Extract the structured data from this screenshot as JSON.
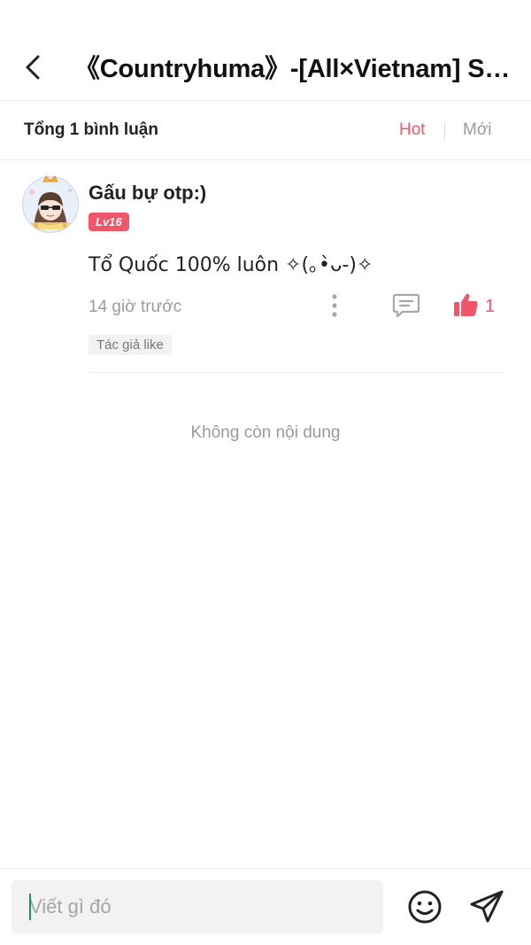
{
  "header": {
    "title": "《Countryhuma》-[All×Vietnam] Sau..."
  },
  "sort_bar": {
    "total_label": "Tổng 1 bình luận",
    "hot_label": "Hot",
    "new_label": "Mới"
  },
  "comments": [
    {
      "username": "Gấu bự otp:)",
      "level": "Lv16",
      "text": "Tổ Quốc 100% luôn ✧(｡•̀ᴗ-)✧",
      "time": "14 giờ trước",
      "likes": "1",
      "author_tag": "Tác giả like"
    }
  ],
  "end_text": "Không còn nội dung",
  "composer": {
    "placeholder": "Viết gì đó"
  },
  "colors": {
    "accent": "#f0566a",
    "muted": "#9a9a9a"
  },
  "icons": {
    "back": "chevron-left-icon",
    "more": "more-vertical-icon",
    "reply": "comment-icon",
    "like": "thumbs-up-icon",
    "emoji": "smiley-icon",
    "send": "send-icon"
  }
}
